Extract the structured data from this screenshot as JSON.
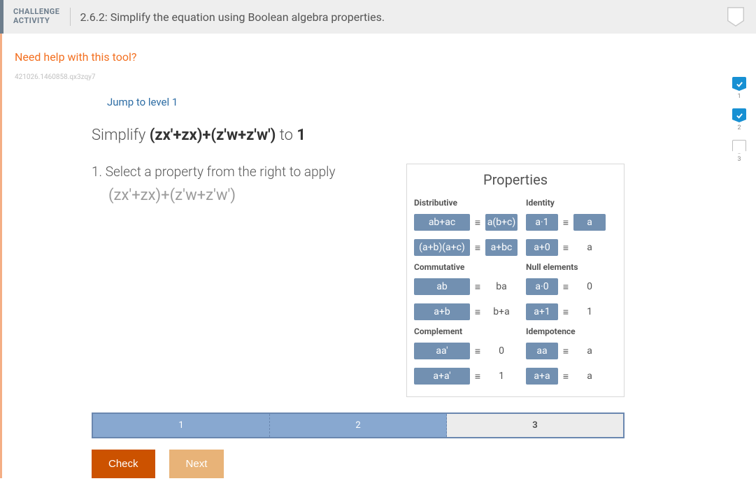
{
  "header": {
    "label_line1": "CHALLENGE",
    "label_line2": "ACTIVITY",
    "title": "2.6.2: Simplify the equation using Boolean algebra properties."
  },
  "help_link": "Need help with this tool?",
  "code_id": "421026.1460858.qx3zqy7",
  "jump_link": "Jump to level 1",
  "prompt_prefix": "Simplify  ",
  "prompt_expr": "(zx'+zx)+(z'w+z'w')",
  "prompt_middle": "  to  ",
  "prompt_target": "1",
  "instruction": "1. Select a property from the right to apply",
  "current_expression": "(zx'+zx)+(z'w+z'w')",
  "properties_title": "Properties",
  "eq_symbol": "≡",
  "groups": {
    "distributive": {
      "label": "Distributive",
      "rows": [
        {
          "left": "ab+ac",
          "left_pill": true,
          "right": "a(b+c)",
          "right_pill": true
        },
        {
          "left": "(a+b)(a+c)",
          "left_pill": true,
          "right": "a+bc",
          "right_pill": true
        }
      ]
    },
    "commutative": {
      "label": "Commutative",
      "rows": [
        {
          "left": "ab",
          "left_pill": true,
          "right": "ba",
          "right_pill": false
        },
        {
          "left": "a+b",
          "left_pill": true,
          "right": "b+a",
          "right_pill": false
        }
      ]
    },
    "complement": {
      "label": "Complement",
      "rows": [
        {
          "left": "aa'",
          "left_pill": true,
          "right": "0",
          "right_pill": false
        },
        {
          "left": "a+a'",
          "left_pill": true,
          "right": "1",
          "right_pill": false
        }
      ]
    },
    "identity": {
      "label": "Identity",
      "rows": [
        {
          "left": "a·1",
          "left_pill": true,
          "right": "a",
          "right_pill": true
        },
        {
          "left": "a+0",
          "left_pill": true,
          "right": "a",
          "right_pill": false
        }
      ]
    },
    "null": {
      "label": "Null elements",
      "rows": [
        {
          "left": "a·0",
          "left_pill": true,
          "right": "0",
          "right_pill": false
        },
        {
          "left": "a+1",
          "left_pill": true,
          "right": "1",
          "right_pill": false
        }
      ]
    },
    "idem": {
      "label": "Idempotence",
      "rows": [
        {
          "left": "aa",
          "left_pill": true,
          "right": "a",
          "right_pill": false
        },
        {
          "left": "a+a",
          "left_pill": true,
          "right": "a",
          "right_pill": false
        }
      ]
    }
  },
  "progress": [
    "1",
    "2",
    "3"
  ],
  "progress_current_index": 2,
  "buttons": {
    "check": "Check",
    "next": "Next"
  },
  "rail": [
    {
      "num": "1",
      "done": true
    },
    {
      "num": "2",
      "done": true
    },
    {
      "num": "3",
      "done": false
    }
  ]
}
